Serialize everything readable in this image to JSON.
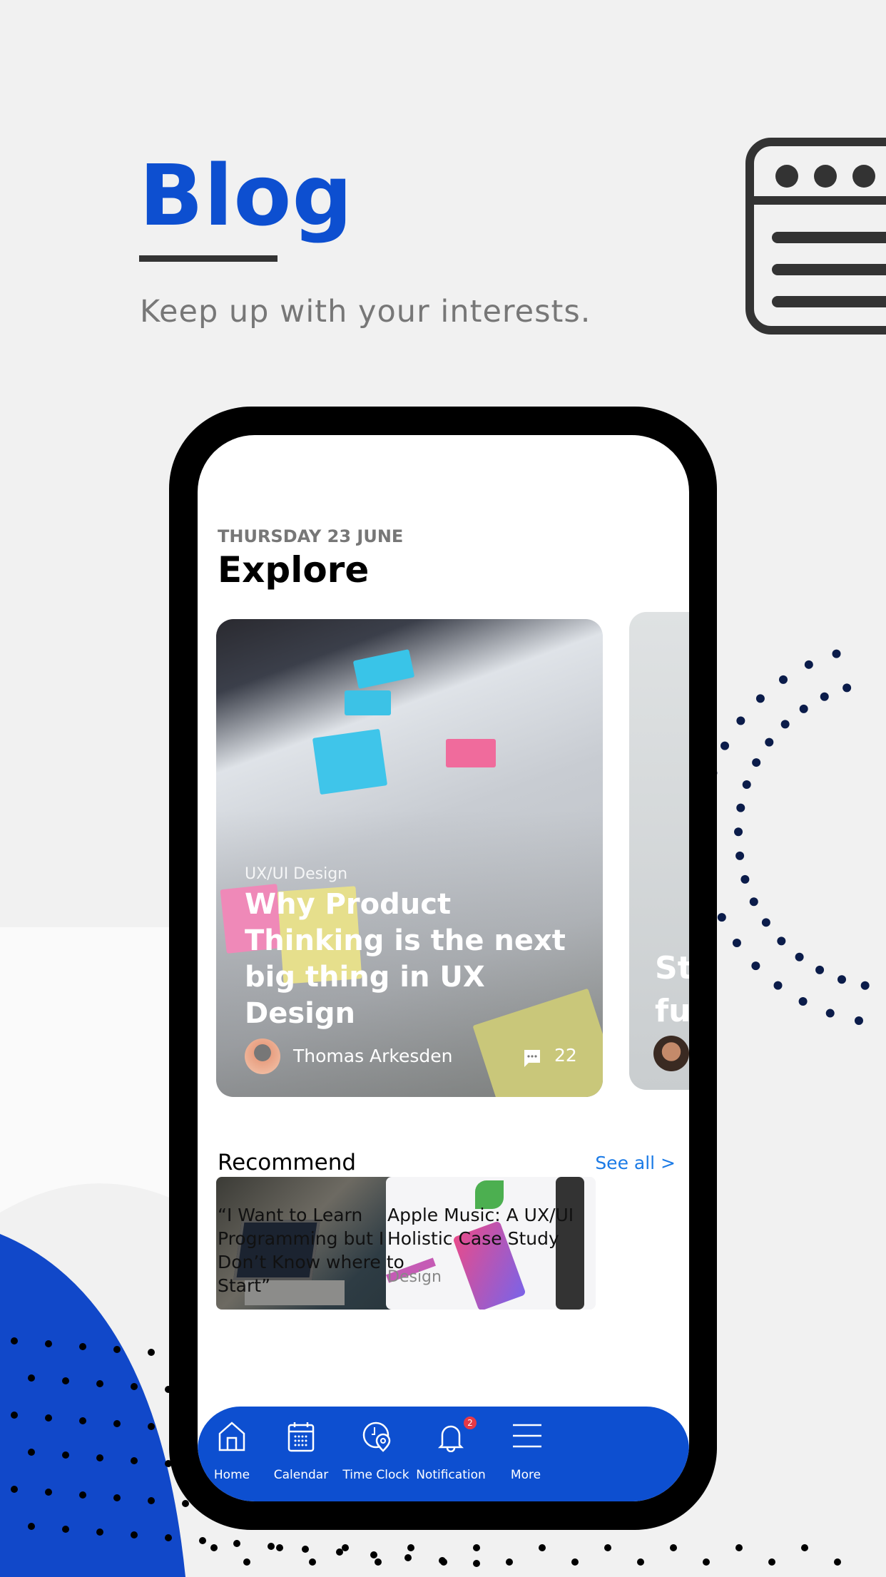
{
  "hero": {
    "title": "Blog",
    "subtitle": "Keep up with your interests.",
    "accent": "#0d4fd0"
  },
  "app": {
    "date": "THURSDAY 23 JUNE",
    "heading": "Explore",
    "featured": {
      "category": "UX/UI Design",
      "title": "Why Product Thinking is the next big thing in UX Design",
      "author": "Thomas Arkesden",
      "comments": "22"
    },
    "featured_next": {
      "title_partial": "St\nfu"
    },
    "recommend": {
      "heading": "Recommend",
      "see_all": "See all >",
      "items": [
        {
          "title": "“I Want to Learn Programming but I Don’t Know where to Start”"
        },
        {
          "title": "Apple Music: A UX/UI Holistic Case Study",
          "category": "Design"
        }
      ]
    },
    "nav": [
      {
        "label": "Home",
        "icon": "home-icon"
      },
      {
        "label": "Calendar",
        "icon": "calendar-icon"
      },
      {
        "label": "Time Clock",
        "icon": "time-clock-icon"
      },
      {
        "label": "Notification",
        "icon": "bell-icon",
        "badge": "2"
      },
      {
        "label": "More",
        "icon": "menu-icon"
      }
    ]
  }
}
